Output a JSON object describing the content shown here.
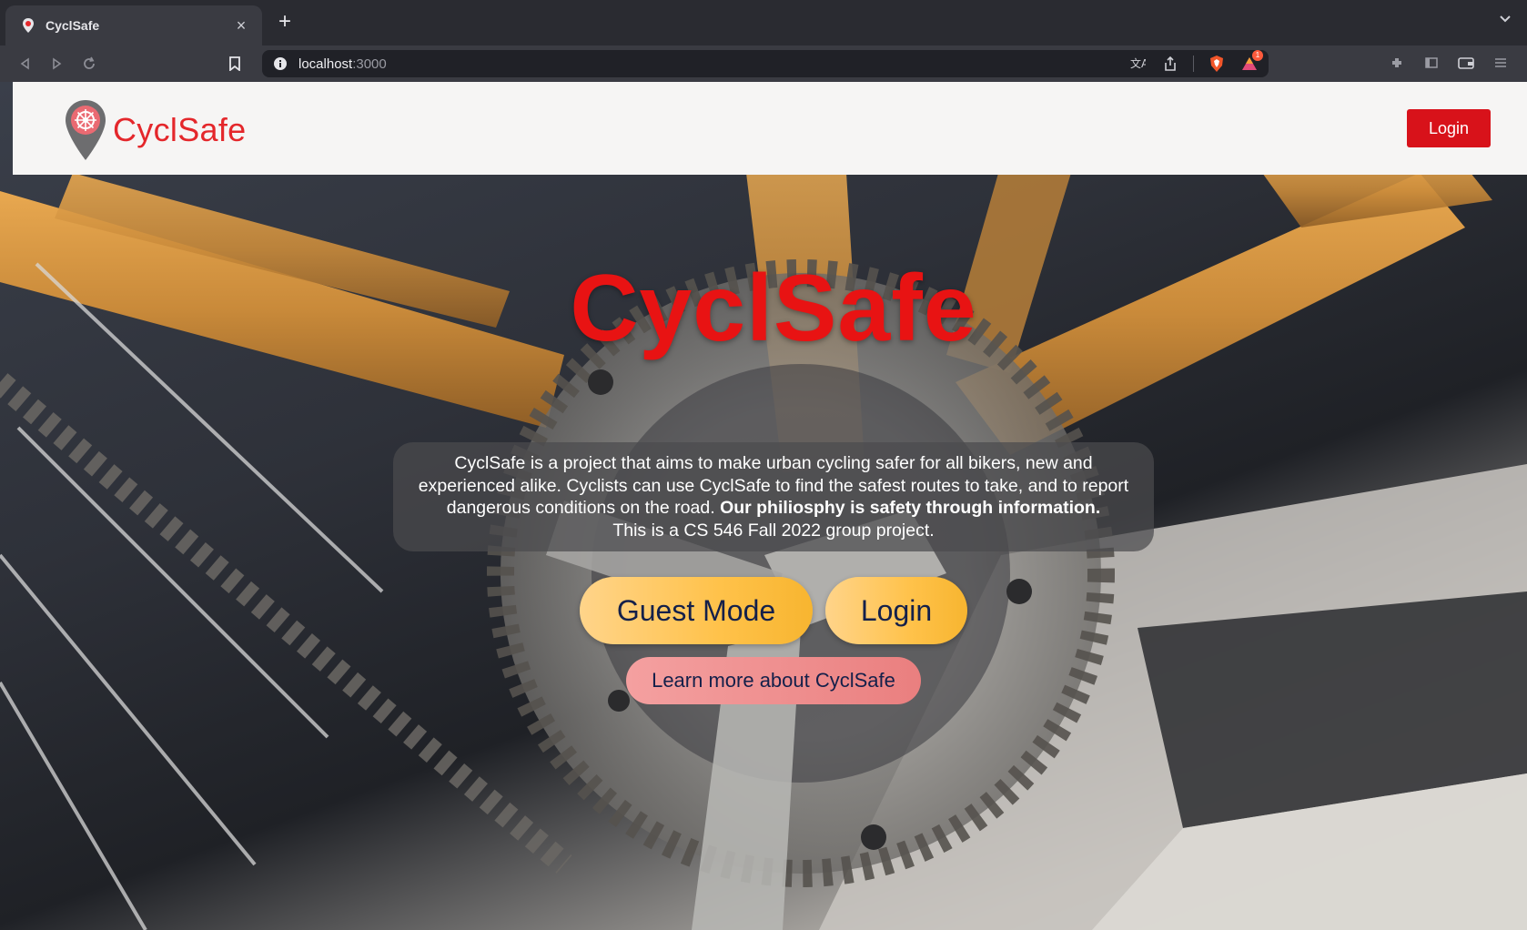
{
  "browser": {
    "tab_title": "CyclSafe",
    "tab_close": "×",
    "new_tab": "+",
    "url_host": "localhost",
    "url_port": ":3000",
    "brave_badge_count": "1"
  },
  "site": {
    "logo_text": "CyclSafe",
    "header_login_label": "Login",
    "hero_title": "CyclSafe",
    "description_plain": "CyclSafe is a project that aims to make urban cycling safer for all bikers, new and experienced alike. Cyclists can use CyclSafe to find the safest routes to take, and to report dangerous conditions on the road.",
    "description_bold": "Our philiosphy is safety through information.",
    "description_tail": "This is a CS 546 Fall 2022 group project.",
    "guest_mode_label": "Guest Mode",
    "login_label": "Login",
    "learn_more_label": "Learn more about CyclSafe"
  },
  "colors": {
    "brand_red": "#e81313",
    "button_yellow": "#ffc24a",
    "button_pink": "#ee8d8d",
    "button_text_navy": "#14204a"
  }
}
